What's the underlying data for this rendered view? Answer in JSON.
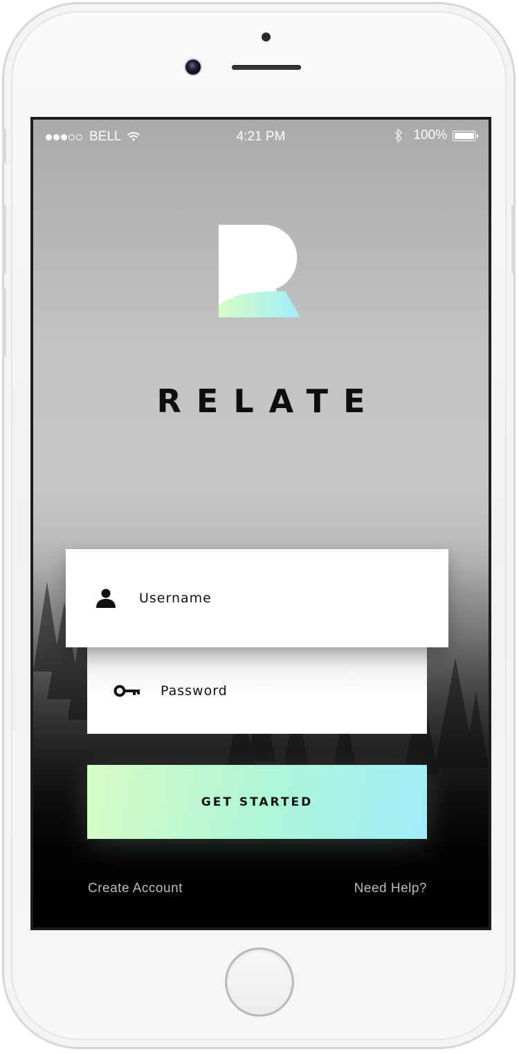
{
  "status_bar": {
    "carrier": "BELL",
    "time": "4:21 PM",
    "battery": "100%",
    "signal_bars_filled": 3,
    "signal_bars_total": 5
  },
  "brand": {
    "name": "RELATE",
    "logo_icon": "relate-r-logo"
  },
  "form": {
    "username_label": "Username",
    "username_icon": "person-icon",
    "password_label": "Password",
    "password_icon": "key-icon",
    "submit_label": "GET STARTED"
  },
  "footer": {
    "create_account": "Create Account",
    "need_help": "Need Help?"
  },
  "colors": {
    "accent_start": "#d8fcc6",
    "accent_end": "#a0eefa",
    "text_dark": "#111111",
    "footer_text": "#bdbdbd"
  }
}
